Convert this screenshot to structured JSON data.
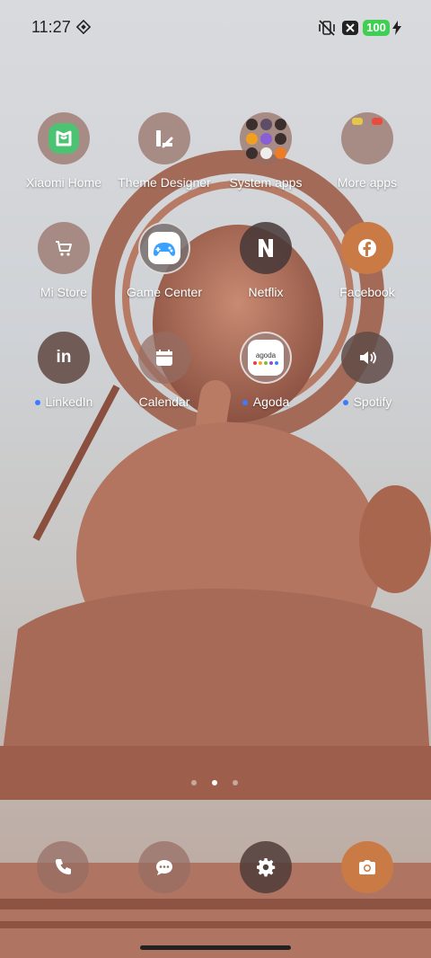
{
  "status_bar": {
    "time": "11:27",
    "battery_level": "100",
    "icons": [
      "nfc-diamond-icon",
      "vibrate-off-icon",
      "x-close-badge-icon",
      "charging-bolt-icon"
    ]
  },
  "apps": [
    {
      "label": "Xiaomi Home",
      "icon": "xiaomi-home-icon",
      "notify": false
    },
    {
      "label": "Theme Designer",
      "icon": "theme-designer-icon",
      "notify": false
    },
    {
      "label": "System apps",
      "icon": "folder-icon",
      "notify": false
    },
    {
      "label": "More apps",
      "icon": "folder-icon",
      "notify": false
    },
    {
      "label": "Mi Store",
      "icon": "cart-icon",
      "notify": false
    },
    {
      "label": "Game Center",
      "icon": "gamepad-icon",
      "notify": false
    },
    {
      "label": "Netflix",
      "icon": "netflix-icon",
      "notify": false
    },
    {
      "label": "Facebook",
      "icon": "facebook-icon",
      "notify": false
    },
    {
      "label": "LinkedIn",
      "icon": "linkedin-icon",
      "notify": true
    },
    {
      "label": "Calendar",
      "icon": "calendar-icon",
      "notify": false
    },
    {
      "label": "Agoda",
      "icon": "agoda-icon",
      "notify": true
    },
    {
      "label": "Spotify",
      "icon": "speaker-icon",
      "notify": true
    }
  ],
  "agoda_text": "agoda",
  "dock": [
    {
      "name": "phone",
      "icon": "phone-icon"
    },
    {
      "name": "messages",
      "icon": "message-icon"
    },
    {
      "name": "settings",
      "icon": "gear-icon"
    },
    {
      "name": "camera",
      "icon": "camera-icon"
    }
  ],
  "page_indicator": {
    "pages": 3,
    "current": 2
  },
  "colors": {
    "notification_dot": "#3c7bff",
    "battery": "#3fcf53",
    "accent_orange": "#c97a45"
  }
}
